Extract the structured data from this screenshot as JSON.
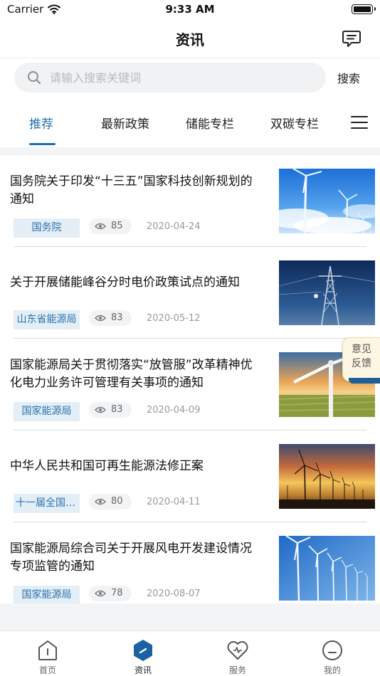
{
  "status_bar": {
    "carrier": "Carrier",
    "time": "9:33 AM"
  },
  "header": {
    "title": "资讯",
    "message_icon": "message-icon"
  },
  "search": {
    "placeholder": "请输入搜索关键词",
    "value": "",
    "button_label": "搜索"
  },
  "tabs": [
    {
      "label": "推荐",
      "active": true
    },
    {
      "label": "最新政策",
      "active": false
    },
    {
      "label": "储能专栏",
      "active": false
    },
    {
      "label": "双碳专栏",
      "active": false
    }
  ],
  "news": [
    {
      "title": "国务院关于印发“十三五”国家科技创新规划的通知",
      "tag": "国务院",
      "views": "85",
      "date": "2020-04-24",
      "image": "wind-turbines-blue-sky"
    },
    {
      "title": "关于开展储能峰谷分时电价政策试点的通知",
      "tag": "山东省能源局",
      "views": "83",
      "date": "2020-05-12",
      "image": "power-tower-dusk"
    },
    {
      "title": "国家能源局关于贯彻落实“放管服”改革精神优化电力业务许可管理有关事项的通知",
      "tag": "国家能源局",
      "views": "83",
      "date": "2020-04-09",
      "image": "wind-turbine-sunset-field"
    },
    {
      "title": "中华人民共和国可再生能源法修正案",
      "tag": "十一届全国人大常委会",
      "views": "80",
      "date": "2020-04-11",
      "image": "wind-farm-golden-sky"
    },
    {
      "title": "国家能源局综合司关于开展风电开发建设情况专项监管的通知",
      "tag": "国家能源局",
      "views": "78",
      "date": "2020-08-07",
      "image": "wind-farm-white-turbines"
    }
  ],
  "feedback": {
    "line1": "意见",
    "line2": "反馈"
  },
  "tabbar": [
    {
      "label": "首页",
      "icon": "home-icon",
      "active": false
    },
    {
      "label": "资讯",
      "icon": "news-icon",
      "active": true
    },
    {
      "label": "服务",
      "icon": "heart-service-icon",
      "active": false
    },
    {
      "label": "我的",
      "icon": "profile-icon",
      "active": false
    }
  ],
  "colors": {
    "accent": "#1f6fae",
    "tag_bg": "#e3eef7",
    "tag_text": "#2b72ac",
    "tabbar_active": "#1a62a3"
  }
}
